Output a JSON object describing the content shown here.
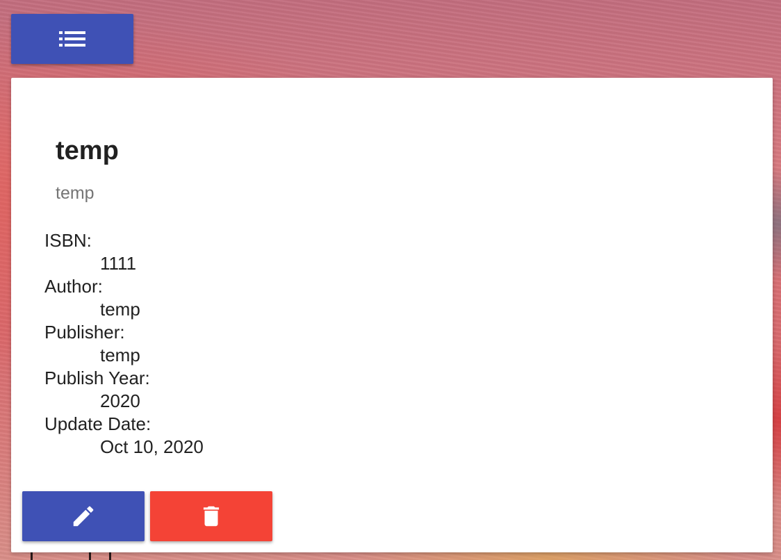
{
  "toolbar": {
    "list_icon": "list-icon"
  },
  "book": {
    "title": "temp",
    "subtitle": "temp",
    "fields": [
      {
        "label": "ISBN:",
        "value": "1111"
      },
      {
        "label": "Author:",
        "value": "temp"
      },
      {
        "label": "Publisher:",
        "value": "temp"
      },
      {
        "label": "Publish Year:",
        "value": "2020"
      },
      {
        "label": "Update Date:",
        "value": "Oct 10, 2020"
      }
    ]
  },
  "actions": {
    "edit_icon": "pencil-icon",
    "delete_icon": "trash-icon"
  },
  "colors": {
    "primary": "#3f51b5",
    "danger": "#f44336",
    "card": "#ffffff"
  }
}
